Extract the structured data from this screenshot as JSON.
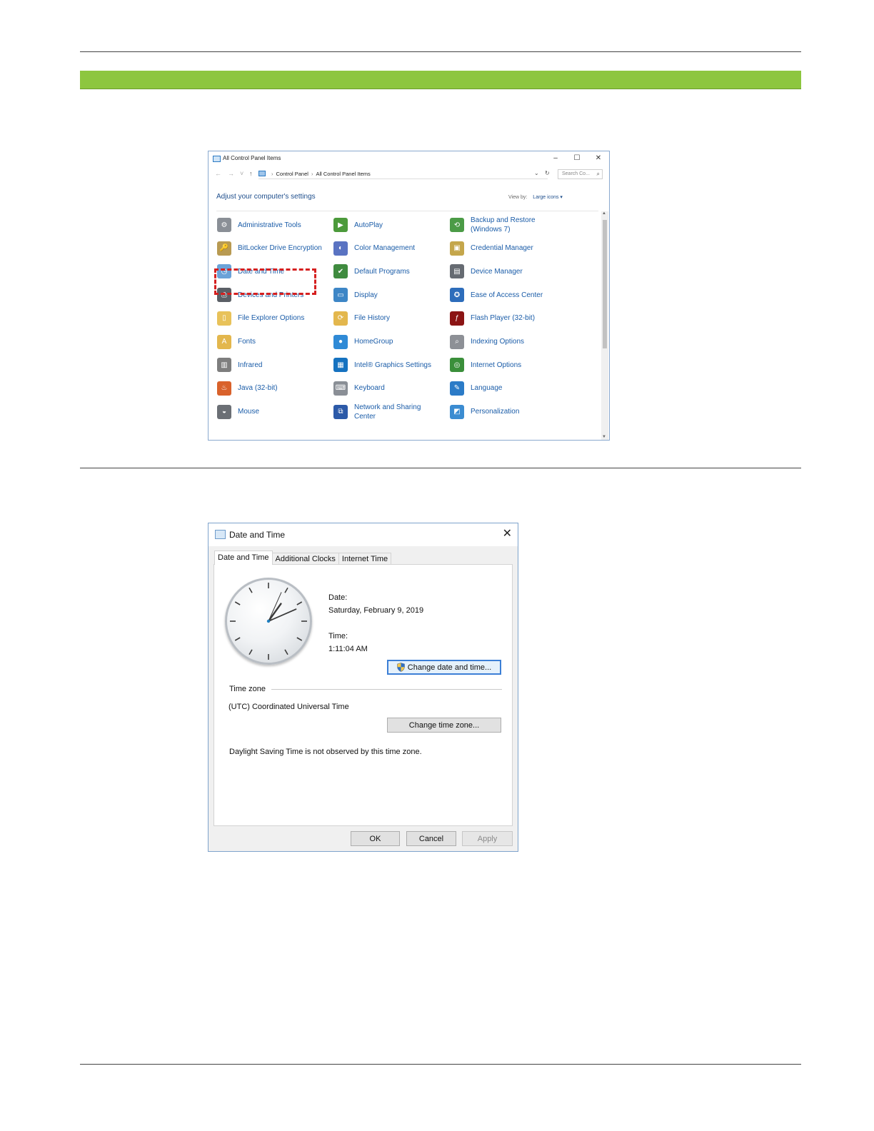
{
  "control_panel": {
    "window_title": "All Control Panel Items",
    "window_controls": [
      "–",
      "☐",
      "✕"
    ],
    "nav": [
      "←",
      "→",
      "˅",
      "↑"
    ],
    "breadcrumb": [
      "Control Panel",
      "All Control Panel Items"
    ],
    "search_placeholder": "Search Co...",
    "heading": "Adjust your computer's settings",
    "view_by_label": "View by:",
    "view_by_value": "Large icons ▾",
    "items": [
      {
        "label": "Administrative Tools",
        "icon": "admin-tools-icon",
        "color": "#8a8f96"
      },
      {
        "label": "AutoPlay",
        "icon": "autoplay-icon",
        "color": "#4c9a3b"
      },
      {
        "label": "Backup and Restore (Windows 7)",
        "icon": "backup-icon",
        "color": "#4b9b46"
      },
      {
        "label": "BitLocker Drive Encryption",
        "icon": "bitlocker-icon",
        "color": "#b89a52"
      },
      {
        "label": "Color Management",
        "icon": "color-management-icon",
        "color": "#5a73c2"
      },
      {
        "label": "Credential Manager",
        "icon": "credential-manager-icon",
        "color": "#c4a64b"
      },
      {
        "label": "Date and Time",
        "icon": "date-time-icon",
        "color": "#6aa2d8"
      },
      {
        "label": "Default Programs",
        "icon": "default-programs-icon",
        "color": "#3f8b3f"
      },
      {
        "label": "Device Manager",
        "icon": "device-manager-icon",
        "color": "#666b72"
      },
      {
        "label": "Devices and Printers",
        "icon": "printer-icon",
        "color": "#5b5f66"
      },
      {
        "label": "Display",
        "icon": "display-icon",
        "color": "#3d86c6"
      },
      {
        "label": "Ease of Access Center",
        "icon": "ease-of-access-icon",
        "color": "#2d6dbb"
      },
      {
        "label": "File Explorer Options",
        "icon": "folder-options-icon",
        "color": "#e8c25a"
      },
      {
        "label": "File History",
        "icon": "file-history-icon",
        "color": "#e3b74d"
      },
      {
        "label": "Flash Player (32-bit)",
        "icon": "flash-player-icon",
        "color": "#8b1414"
      },
      {
        "label": "Fonts",
        "icon": "fonts-icon",
        "color": "#e3b74d"
      },
      {
        "label": "HomeGroup",
        "icon": "homegroup-icon",
        "color": "#2f8ad6"
      },
      {
        "label": "Indexing Options",
        "icon": "indexing-options-icon",
        "color": "#8d9096"
      },
      {
        "label": "Infrared",
        "icon": "infrared-icon",
        "color": "#7e7e7e"
      },
      {
        "label": "Intel® Graphics Settings",
        "icon": "intel-graphics-icon",
        "color": "#1572c0"
      },
      {
        "label": "Internet Options",
        "icon": "internet-options-icon",
        "color": "#3a8f3a"
      },
      {
        "label": "Java (32-bit)",
        "icon": "java-icon",
        "color": "#d9622b"
      },
      {
        "label": "Keyboard",
        "icon": "keyboard-icon",
        "color": "#8a8f96"
      },
      {
        "label": "Language",
        "icon": "language-icon",
        "color": "#2b7bc7"
      },
      {
        "label": "Mouse",
        "icon": "mouse-icon",
        "color": "#6b6f75"
      },
      {
        "label": "Network and Sharing Center",
        "icon": "network-icon",
        "color": "#2c5aa8"
      },
      {
        "label": "Personalization",
        "icon": "personalization-icon",
        "color": "#3b8cd1"
      }
    ]
  },
  "date_time_dialog": {
    "title": "Date and Time",
    "close": "✕",
    "tabs": [
      "Date and Time",
      "Additional Clocks",
      "Internet Time"
    ],
    "date_label": "Date:",
    "date_value": "Saturday, February 9, 2019",
    "time_label": "Time:",
    "time_value": "1:11:04 AM",
    "change_datetime_button": "Change date and time...",
    "time_zone_heading": "Time zone",
    "time_zone_value": "(UTC) Coordinated Universal Time",
    "change_timezone_button": "Change time zone...",
    "dst_note": "Daylight Saving Time is not observed by this time zone.",
    "ok_button": "OK",
    "cancel_button": "Cancel",
    "apply_button": "Apply",
    "clock_time": {
      "hour": 1,
      "minute": 11,
      "second": 4
    }
  }
}
